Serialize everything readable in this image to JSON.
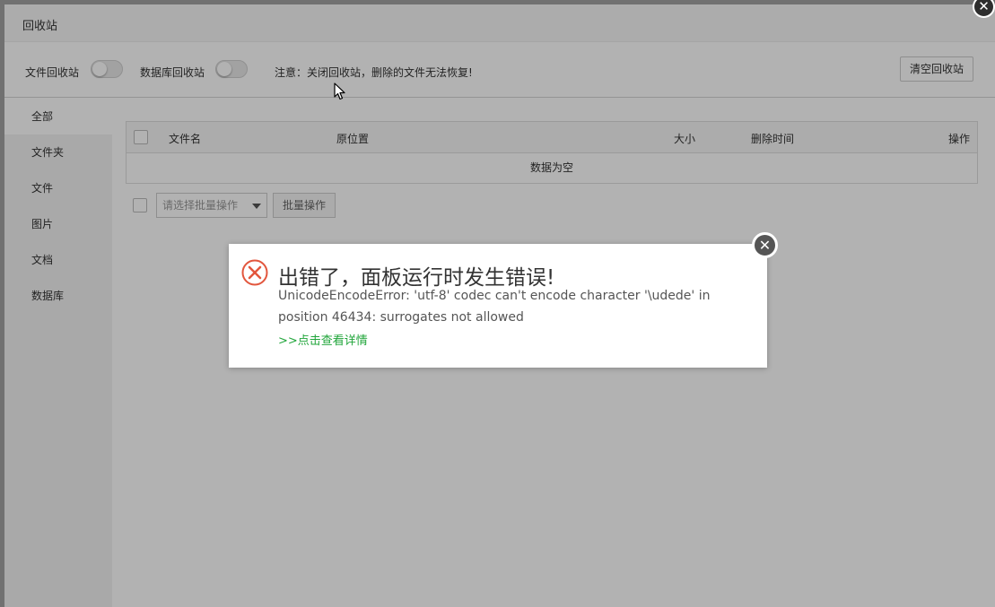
{
  "window": {
    "title": "回收站",
    "close_glyph": "✕"
  },
  "toolbar": {
    "file_recycle_label": "文件回收站",
    "db_recycle_label": "数据库回收站",
    "notice": "注意：关闭回收站，删除的文件无法恢复!",
    "clear_button": "清空回收站",
    "file_recycle_on": false,
    "db_recycle_on": false
  },
  "sidebar": {
    "items": [
      {
        "label": "全部",
        "active": true
      },
      {
        "label": "文件夹"
      },
      {
        "label": "文件"
      },
      {
        "label": "图片"
      },
      {
        "label": "文档"
      },
      {
        "label": "数据库"
      }
    ]
  },
  "table": {
    "columns": [
      "文件名",
      "原位置",
      "大小",
      "删除时间",
      "操作"
    ],
    "empty_text": "数据为空"
  },
  "batch": {
    "select_placeholder": "请选择批量操作",
    "button": "批量操作"
  },
  "dialog": {
    "title": "出错了，面板运行时发生错误!",
    "message": "UnicodeEncodeError: 'utf-8' codec can't encode character '\\udede' in position 46434: surrogates not allowed",
    "link": ">>点击查看详情",
    "close_glyph": "✕",
    "icon": "error-circle-x-icon",
    "link_color": "#20a53a",
    "error_color": "#e2563d"
  }
}
